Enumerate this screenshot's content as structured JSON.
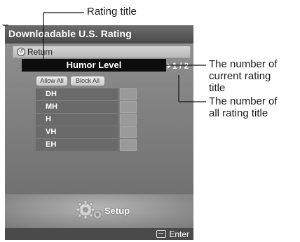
{
  "menu": {
    "title": "Downloadable U.S. Rating",
    "return_label": "Return",
    "rating_title": "Humor Level",
    "page_indicator": "1 / 2",
    "allow_all": "Allow All",
    "block_all": "Block All",
    "rows": [
      {
        "label": "DH"
      },
      {
        "label": "MH"
      },
      {
        "label": "H"
      },
      {
        "label": "VH"
      },
      {
        "label": "EH"
      }
    ],
    "footer_label": "Setup",
    "enter_label": "Enter"
  },
  "callouts": {
    "rating_title": "Rating title",
    "current_rating_line1": "The number of",
    "current_rating_line2": "current rating",
    "current_rating_line3": "title",
    "all_rating_line1": "The number of",
    "all_rating_line2": "all rating title"
  },
  "icons": {
    "return": "return-icon",
    "setup": "gear-icon",
    "enter": "enter-icon"
  }
}
